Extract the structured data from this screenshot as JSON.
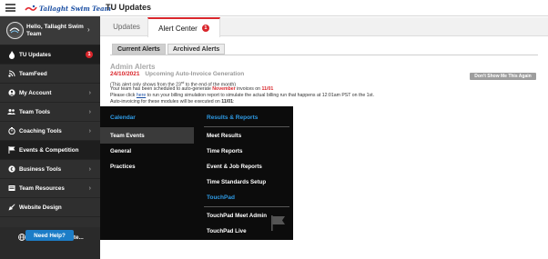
{
  "header": {
    "logo_text": "Tallaght Swim Team",
    "page_title": "TU Updates"
  },
  "sidebar": {
    "profile_line1": "Hello, Tallaght Swim",
    "profile_line2": "Team",
    "items": [
      {
        "label": "TU Updates",
        "icon": "fire-icon",
        "badge": "1"
      },
      {
        "label": "TeamFeed",
        "icon": "feed-icon"
      },
      {
        "label": "My Account",
        "icon": "account-icon"
      },
      {
        "label": "Team Tools",
        "icon": "team-icon"
      },
      {
        "label": "Coaching Tools",
        "icon": "coaching-icon"
      },
      {
        "label": "Events & Competition",
        "icon": "flag-icon"
      },
      {
        "label": "Business Tools",
        "icon": "business-icon"
      },
      {
        "label": "Team Resources",
        "icon": "resources-icon"
      },
      {
        "label": "Website Design",
        "icon": "website-icon"
      }
    ],
    "view_website": "View team website...",
    "need_help": "Need Help?"
  },
  "tabs": {
    "updates": "Updates",
    "alert_center": "Alert Center",
    "alert_badge": "1"
  },
  "subtabs": {
    "current": "Current Alerts",
    "archived": "Archived Alerts"
  },
  "alerts": {
    "section_title": "Admin Alerts",
    "date": "24/10/2021",
    "title": "Upcoming Auto-Invoice Generation",
    "dont_show": "Don't Show Me This Again",
    "line1_a": "(This alert only shows from the 23",
    "line1_sup": "rd",
    "line1_b": " to the end of the month)",
    "line2_a": "Your team has been scheduled to auto-generate ",
    "line2_month": "November",
    "line2_b": " invoices on ",
    "line2_date": "11/01",
    "line3_a": "Please click ",
    "line3_link": "here",
    "line3_b": " to run your billing simulation report to simulate the actual billing run that happens at 12:01am PST on the 1st.",
    "line4_a": "Auto-invoicing for these modules will be executed on ",
    "line4_date": "11/01",
    "line4_b": ":"
  },
  "mega_menu": {
    "calendar_head": "Calendar",
    "calendar_items": [
      "Team Events",
      "General",
      "Practices"
    ],
    "results_head": "Results & Reports",
    "results_items": [
      "Meet Results",
      "Time Reports",
      "Event & Job Reports",
      "Time Standards Setup"
    ],
    "touchpad_head": "TouchPad",
    "touchpad_items": [
      "TouchPad Meet Admin",
      "TouchPad Live"
    ]
  },
  "colors": {
    "accent_blue": "#2e9be6",
    "alert_red": "#d9262c",
    "sidebar_bg": "#2f2f2f",
    "help_button": "#1c7dc7"
  }
}
